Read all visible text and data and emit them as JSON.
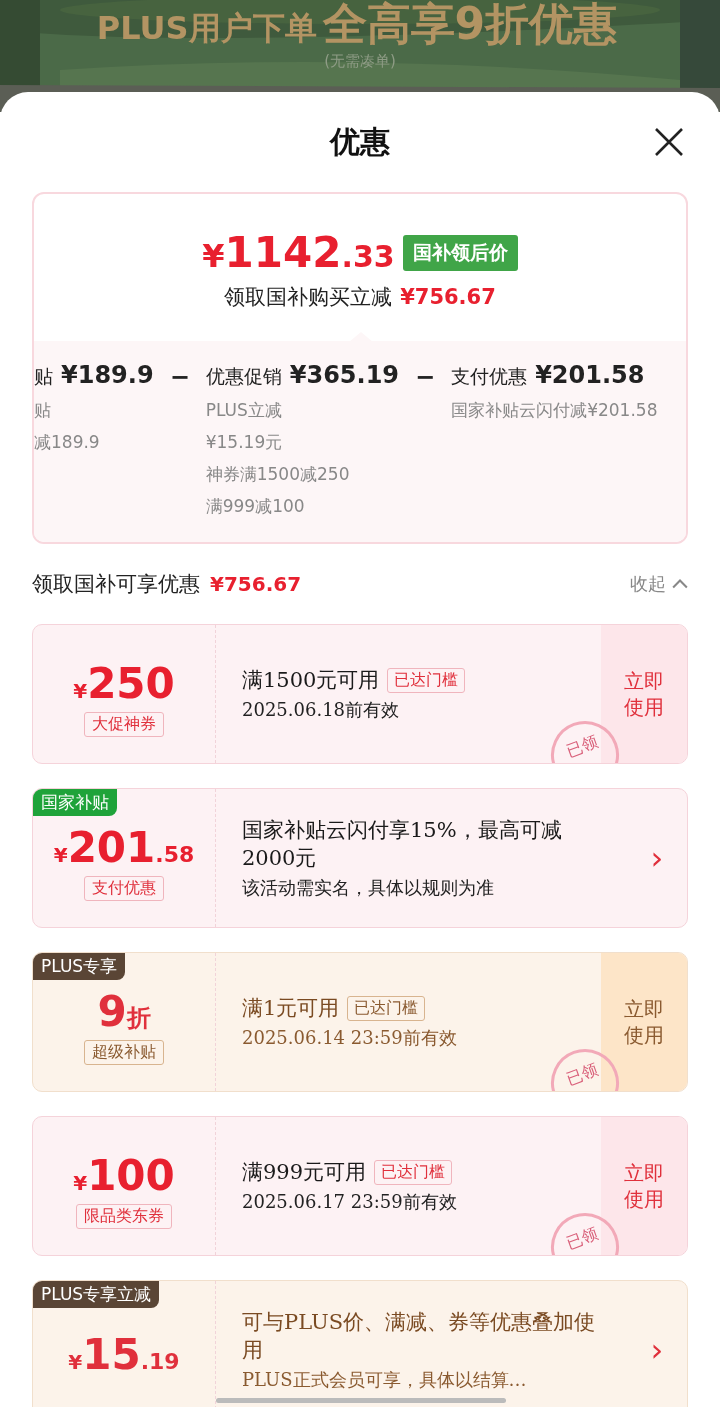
{
  "banner": {
    "headline": "PLUS用户下单",
    "highlight": "全高享9折优惠",
    "note": "(无需凑单)"
  },
  "sheet": {
    "title": "优惠"
  },
  "price_card": {
    "currency": "¥",
    "amount": "1142",
    "decimals": ".33",
    "badge": "国补领后价",
    "saving_label": "领取国补购买立减",
    "saving": "¥756.67",
    "breakdown": [
      {
        "title": "贴",
        "amount": "¥189.9",
        "lines": [
          "贴",
          "减189.9"
        ]
      },
      {
        "title": "优惠促销",
        "amount": "¥365.19",
        "operator": "−",
        "lines": [
          "PLUS立减",
          "¥15.19元",
          "神券满1500减250",
          "满999减100"
        ]
      },
      {
        "title": "支付优惠",
        "amount": "¥201.58",
        "operator": "−",
        "lines": [
          "国家补贴云闪付减¥201.58"
        ]
      }
    ]
  },
  "section": {
    "title": "领取国补可享优惠",
    "amount": "¥756.67",
    "toggle": "收起",
    "expanded": true
  },
  "coupons": [
    {
      "kind": "ticket",
      "plus": false,
      "prefix": "¥",
      "main": "250",
      "label": "大促神券",
      "title": "满1500元可用",
      "chip": "已达门槛",
      "detail": "2025.06.18前有效",
      "action": "立即使用",
      "stamp": "已领"
    },
    {
      "kind": "info",
      "plus": false,
      "tag": "国家补贴",
      "color": "#1fa33a",
      "prefix": "¥",
      "main": "201",
      "suffix": ".58",
      "label": "支付优惠",
      "title": "国家补贴云闪付享15%，最高可减2000元",
      "detail": "该活动需实名，具体以规则为准",
      "action": "›"
    },
    {
      "kind": "ticket",
      "plus": true,
      "tag": "PLUS专享",
      "color": "#5a4535",
      "main": "9",
      "suffix": "折",
      "label": "超级补贴",
      "title": "满1元可用",
      "chip": "已达门槛",
      "detail": "2025.06.14 23:59前有效",
      "action": "立即使用",
      "stamp": "已领"
    },
    {
      "kind": "ticket",
      "plus": false,
      "prefix": "¥",
      "main": "100",
      "label": "限品类东券",
      "title": "满999元可用",
      "chip": "已达门槛",
      "detail": "2025.06.17 23:59前有效",
      "action": "立即使用",
      "stamp": "已领"
    },
    {
      "kind": "info",
      "plus": true,
      "tag": "PLUS专享立减",
      "color": "#5a4535",
      "prefix": "¥",
      "main": "15",
      "suffix": ".19",
      "title": "可与PLUS价、满减、券等优惠叠加使用",
      "detail": "PLUS正式会员可享，具体以结算…",
      "action": "›"
    }
  ]
}
